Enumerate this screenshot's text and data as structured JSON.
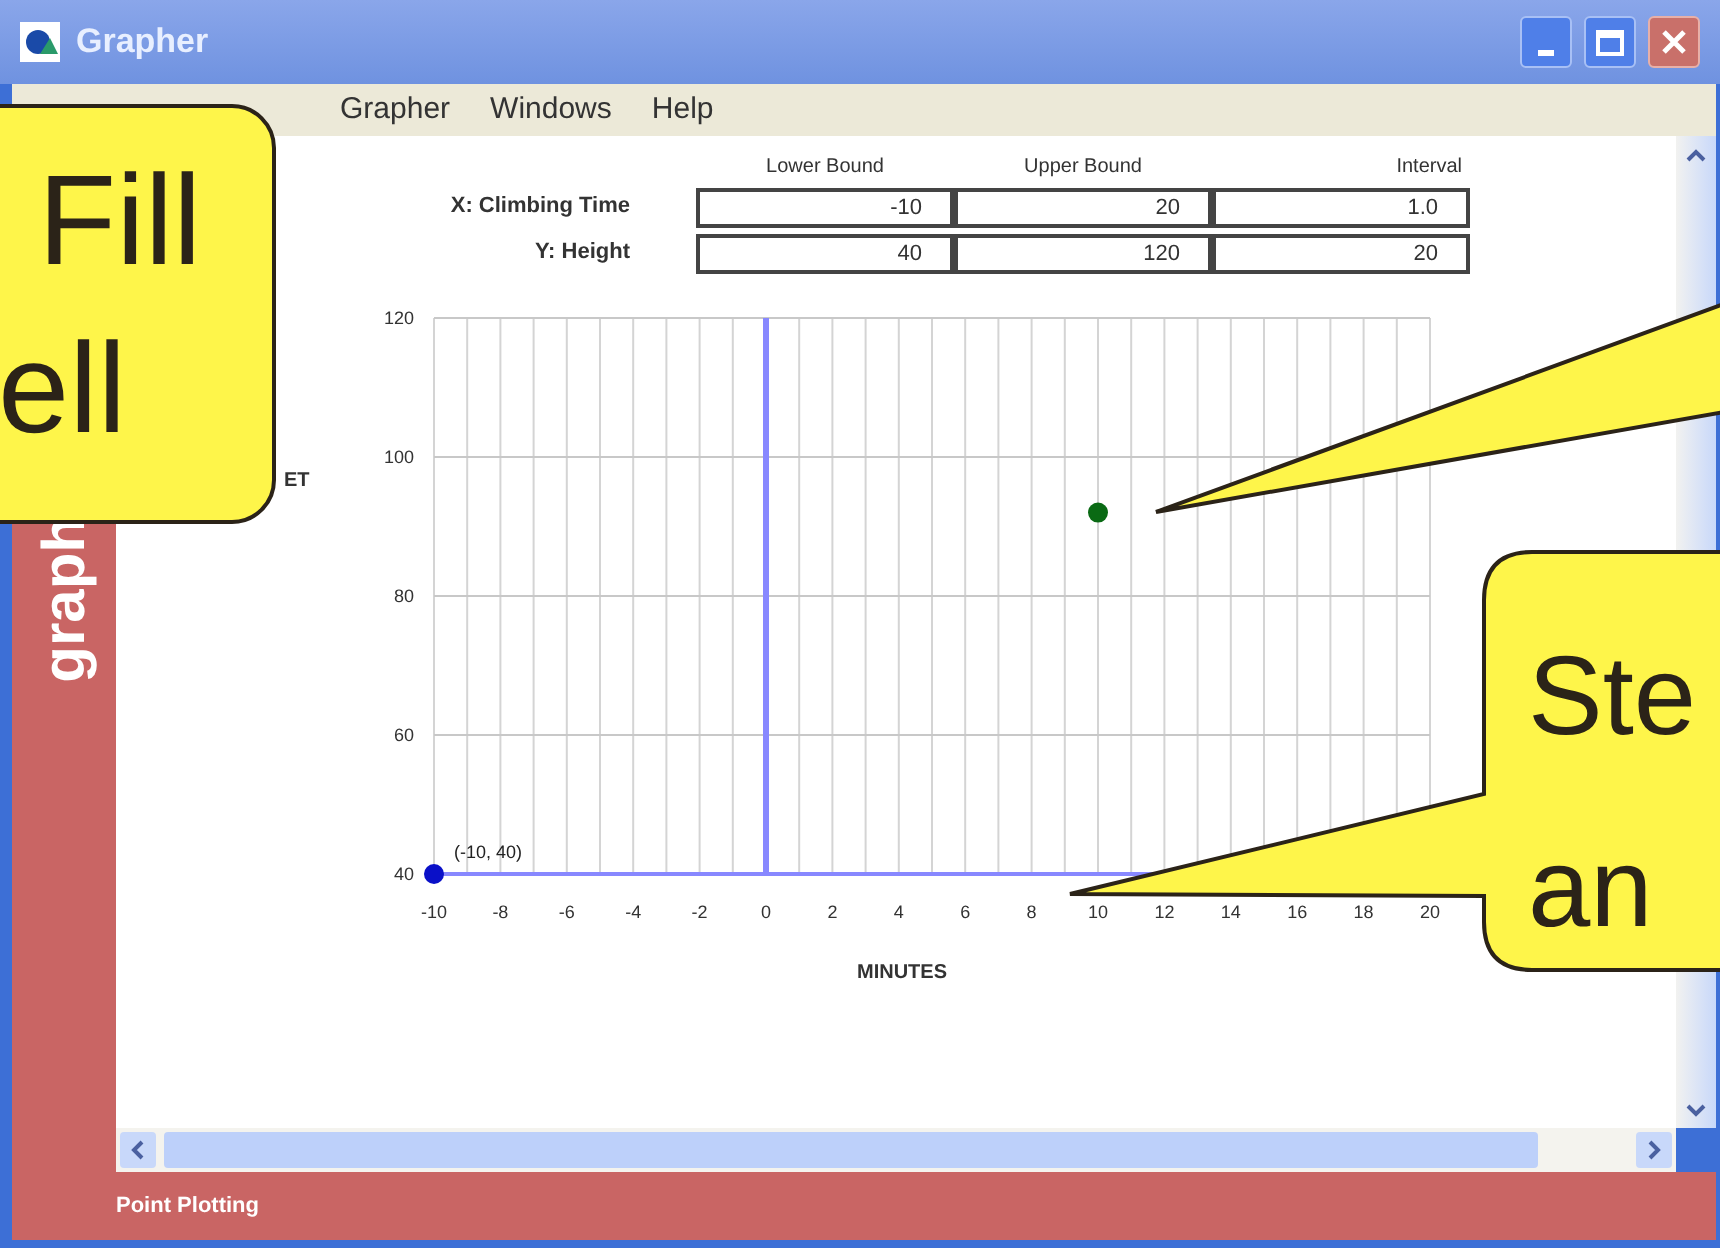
{
  "window": {
    "title": "Grapher"
  },
  "menu": [
    "Grapher",
    "Windows",
    "Help"
  ],
  "bounds": {
    "columns": [
      "Lower Bound",
      "Upper Bound",
      "Interval"
    ],
    "rows": [
      {
        "label": "X: Climbing Time",
        "values": [
          "-10",
          "20",
          "1.0"
        ]
      },
      {
        "label": "Y: Height",
        "values": [
          "40",
          "120",
          "20"
        ]
      }
    ]
  },
  "sidebar": {
    "logo": "graph"
  },
  "chart_data": {
    "type": "scatter",
    "xlabel": "MINUTES",
    "ylabel": "ET",
    "x": [
      -10,
      10
    ],
    "series": [
      {
        "color": "#0a10c8",
        "values": [
          40,
          null
        ]
      },
      {
        "color": "#0a6a14",
        "values": [
          null,
          92
        ]
      }
    ],
    "grid": true,
    "ref_lines": [
      {
        "axis": "x",
        "value": 0
      }
    ],
    "xlim": [
      -10,
      20
    ],
    "ylim": [
      40,
      120
    ],
    "xticks": [
      -10,
      -8,
      -6,
      -4,
      -2,
      0,
      2,
      4,
      6,
      8,
      10,
      12,
      14,
      16,
      18,
      20
    ],
    "yticks": [
      40,
      60,
      80,
      100,
      120
    ],
    "annotations": [
      {
        "x": -10,
        "y": 40,
        "text": "(-10, 40)"
      }
    ]
  },
  "status_bar": "Point Plotting",
  "callouts": [
    {
      "kind": "box",
      "lines": [
        "Fill",
        "ell"
      ]
    },
    {
      "kind": "pointer"
    },
    {
      "kind": "bubble",
      "lines": [
        "Ste",
        "an"
      ]
    }
  ]
}
